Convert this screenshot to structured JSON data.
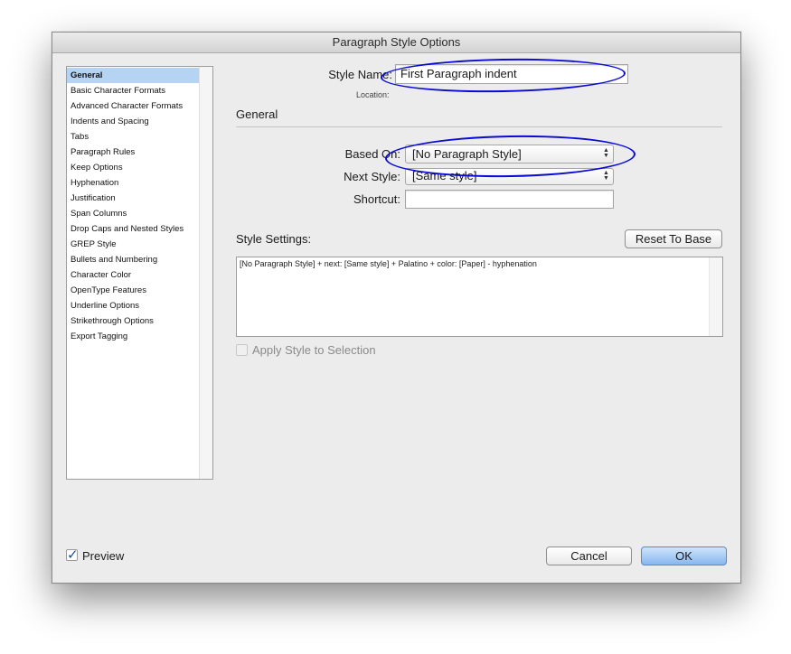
{
  "window": {
    "title": "Paragraph Style Options"
  },
  "sidebar": {
    "items": [
      {
        "label": "General",
        "selected": true
      },
      {
        "label": "Basic Character Formats"
      },
      {
        "label": "Advanced Character Formats"
      },
      {
        "label": "Indents and Spacing"
      },
      {
        "label": "Tabs"
      },
      {
        "label": "Paragraph Rules"
      },
      {
        "label": "Keep Options"
      },
      {
        "label": "Hyphenation"
      },
      {
        "label": "Justification"
      },
      {
        "label": "Span Columns"
      },
      {
        "label": "Drop Caps and Nested Styles"
      },
      {
        "label": "GREP Style"
      },
      {
        "label": "Bullets and Numbering"
      },
      {
        "label": "Character Color"
      },
      {
        "label": "OpenType Features"
      },
      {
        "label": "Underline Options"
      },
      {
        "label": "Strikethrough Options"
      },
      {
        "label": "Export Tagging"
      }
    ]
  },
  "form": {
    "style_name_label": "Style Name:",
    "style_name_value": "First Paragraph indent",
    "location_label": "Location:",
    "section_title": "General",
    "based_on_label": "Based On:",
    "based_on_value": "[No Paragraph Style]",
    "next_style_label": "Next Style:",
    "next_style_value": "[Same style]",
    "shortcut_label": "Shortcut:",
    "shortcut_value": "",
    "style_settings_label": "Style Settings:",
    "reset_button": "Reset To Base",
    "style_settings_text": "[No Paragraph Style] + next: [Same style] + Palatino + color: [Paper] - hyphenation",
    "apply_style_label": "Apply Style to Selection"
  },
  "footer": {
    "preview_label": "Preview",
    "preview_checked": true,
    "cancel_button": "Cancel",
    "ok_button": "OK"
  },
  "annotations": {
    "highlight_color": "#0a0ad6"
  }
}
